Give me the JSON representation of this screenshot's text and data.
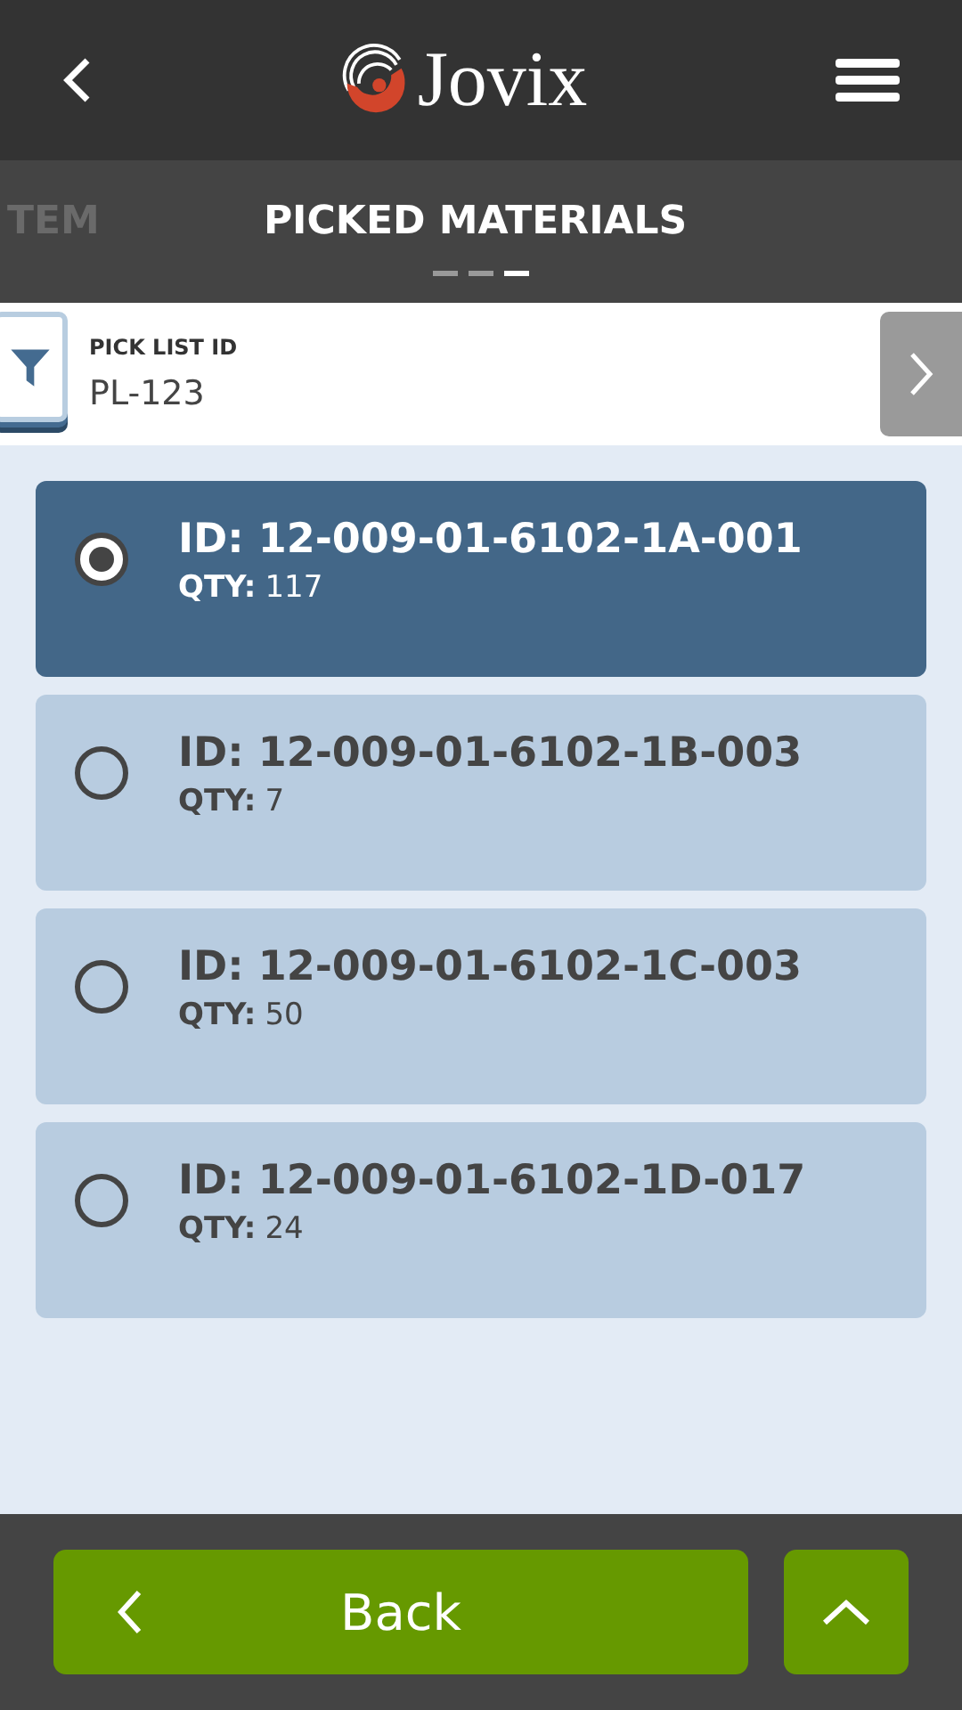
{
  "header": {
    "logo_text": "Jovix"
  },
  "tabs": [
    {
      "label": "TEM",
      "selected": false
    },
    {
      "label": "PICKED MATERIALS",
      "selected": true
    }
  ],
  "pager": [
    {
      "selected": false
    },
    {
      "selected": false
    },
    {
      "selected": true
    }
  ],
  "filter": {
    "label": "PICK LIST ID",
    "value": "PL-123"
  },
  "items": [
    {
      "id": "ID: 12-009-01-6102-1A-001",
      "qty_label": "QTY:",
      "qty": "117",
      "selected": true
    },
    {
      "id": "ID: 12-009-01-6102-1B-003",
      "qty_label": "QTY:",
      "qty": "7",
      "selected": false
    },
    {
      "id": "ID: 12-009-01-6102-1C-003",
      "qty_label": "QTY:",
      "qty": "50",
      "selected": false
    },
    {
      "id": "ID: 12-009-01-6102-1D-017",
      "qty_label": "QTY:",
      "qty": "24",
      "selected": false
    }
  ],
  "footer": {
    "back_label": "Back"
  }
}
